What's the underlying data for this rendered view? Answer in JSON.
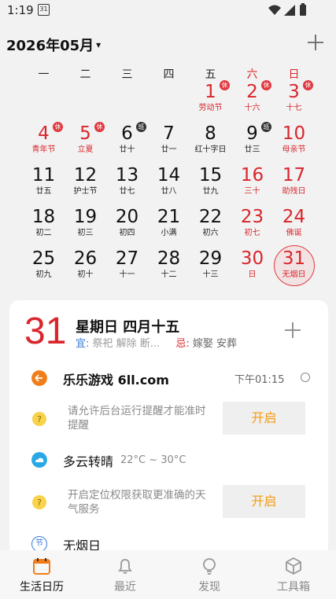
{
  "status_bar": {
    "time": "1:19",
    "calendar_icon_day": "31"
  },
  "header": {
    "month_title": "2026年05月",
    "caret": "▾"
  },
  "weekdays": [
    "一",
    "二",
    "三",
    "四",
    "五",
    "六",
    "日"
  ],
  "weeks": [
    [
      null,
      null,
      null,
      null,
      {
        "day": "1",
        "sub": "劳动节",
        "red": true,
        "badge": "休"
      },
      {
        "day": "2",
        "sub": "十六",
        "red": true,
        "badge": "休"
      },
      {
        "day": "3",
        "sub": "十七",
        "red": true,
        "badge": "休"
      }
    ],
    [
      {
        "day": "4",
        "sub": "青年节",
        "red": true,
        "badge": "休"
      },
      {
        "day": "5",
        "sub": "立夏",
        "red": true,
        "badge": "休"
      },
      {
        "day": "6",
        "sub": "廿十",
        "badge": "班"
      },
      {
        "day": "7",
        "sub": "廿一"
      },
      {
        "day": "8",
        "sub": "红十字日"
      },
      {
        "day": "9",
        "sub": "廿三",
        "badge": "班"
      },
      {
        "day": "10",
        "sub": "母亲节",
        "red": true
      }
    ],
    [
      {
        "day": "11",
        "sub": "廿五"
      },
      {
        "day": "12",
        "sub": "护士节"
      },
      {
        "day": "13",
        "sub": "廿七"
      },
      {
        "day": "14",
        "sub": "廿八"
      },
      {
        "day": "15",
        "sub": "廿九"
      },
      {
        "day": "16",
        "sub": "三十",
        "red": true
      },
      {
        "day": "17",
        "sub": "助残日",
        "red": true
      }
    ],
    [
      {
        "day": "18",
        "sub": "初二"
      },
      {
        "day": "19",
        "sub": "初三"
      },
      {
        "day": "20",
        "sub": "初四"
      },
      {
        "day": "21",
        "sub": "小满"
      },
      {
        "day": "22",
        "sub": "初六"
      },
      {
        "day": "23",
        "sub": "初七",
        "red": true
      },
      {
        "day": "24",
        "sub": "佛诞",
        "red": true
      }
    ],
    [
      {
        "day": "25",
        "sub": "初九"
      },
      {
        "day": "26",
        "sub": "初十"
      },
      {
        "day": "27",
        "sub": "十一"
      },
      {
        "day": "28",
        "sub": "十二"
      },
      {
        "day": "29",
        "sub": "十三"
      },
      {
        "day": "30",
        "sub": "日",
        "red": true
      },
      {
        "day": "31",
        "sub": "无烟日",
        "red": true,
        "today": true
      }
    ]
  ],
  "detail": {
    "big_day": "31",
    "date_line": "星期日 四月十五",
    "yi_label": "宜:",
    "yi_text": "祭祀 解除 断...",
    "ji_label": "忌:",
    "ji_text": "嫁娶 安葬"
  },
  "items": {
    "event": {
      "title": "乐乐游戏 6ll.com",
      "time": "下午01:15"
    },
    "bg_permission": {
      "hint": "请允许后台运行提醒才能准时提醒",
      "button": "开启"
    },
    "weather": {
      "title": "多云转晴",
      "temp": "22°C ~ 30°C"
    },
    "location_permission": {
      "hint": "开启定位权限获取更准确的天气服务",
      "button": "开启"
    },
    "holiday": {
      "icon_text": "节",
      "title": "无烟日"
    }
  },
  "tabs": [
    {
      "label": "生活日历",
      "icon": "calendar-icon",
      "active": true
    },
    {
      "label": "最近",
      "icon": "bell-icon"
    },
    {
      "label": "发现",
      "icon": "bulb-icon"
    },
    {
      "label": "工具箱",
      "icon": "box-icon"
    }
  ],
  "colors": {
    "red": "#d9262c",
    "orange": "#f39c12",
    "blue": "#3a7bd5"
  }
}
